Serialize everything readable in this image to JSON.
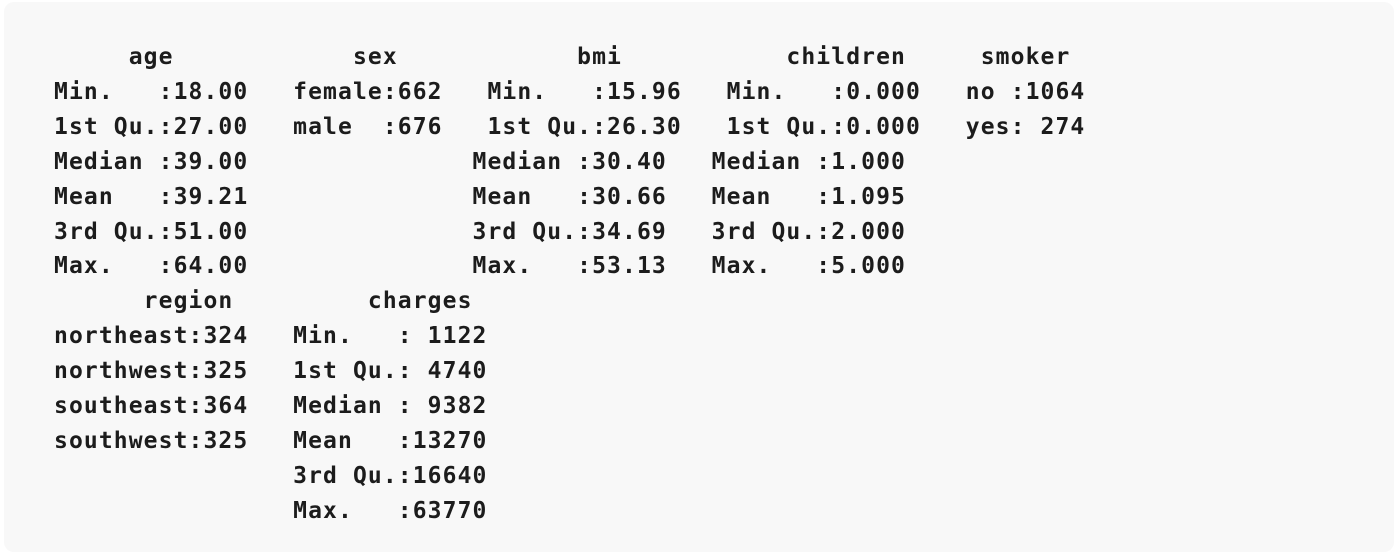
{
  "summary_output": {
    "lines": [
      "     age            sex            bmi           children     smoker",
      "Min.   :18.00   female:662   Min.   :15.96   Min.   :0.000   no :1064",
      "1st Qu.:27.00   male  :676   1st Qu.:26.30   1st Qu.:0.000   yes: 274",
      "Median :39.00               Median :30.40   Median :1.000",
      "Mean   :39.21               Mean   :30.66   Mean   :1.095",
      "3rd Qu.:51.00               3rd Qu.:34.69   3rd Qu.:2.000",
      "Max.   :64.00               Max.   :53.13   Max.   :5.000",
      "      region         charges",
      "northeast:324   Min.   : 1122",
      "northwest:325   1st Qu.: 4740",
      "southeast:364   Median : 9382",
      "southwest:325   Mean   :13270",
      "                3rd Qu.:16640",
      "                Max.   :63770"
    ]
  }
}
